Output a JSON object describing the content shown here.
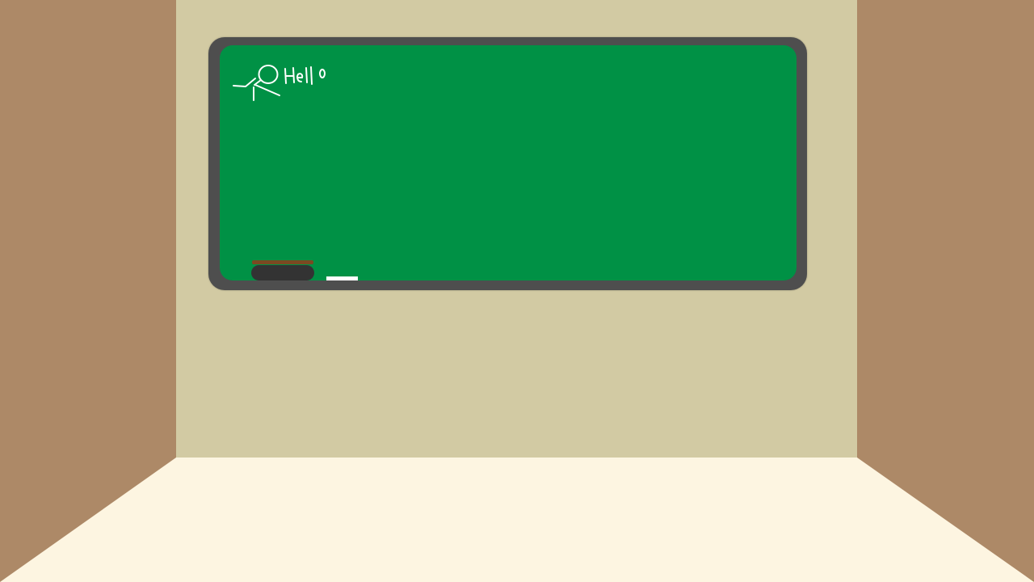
{
  "scene": {
    "colors": {
      "side_walls": "#ad8967",
      "back_wall": "#d2caa3",
      "floor": "#fdf5e1",
      "board_frame": "#4e4e4e",
      "board_surface": "#009145",
      "chalk_stroke": "#ffffff",
      "eraser_body": "#333333",
      "eraser_felt": "#7a4a22",
      "chalk": "#ffffff"
    },
    "chalkboard": {
      "handwriting": "Hello",
      "doodle": "stick-figure"
    },
    "tools": {
      "eraser": "eraser-icon",
      "chalk": "chalk-icon"
    }
  }
}
